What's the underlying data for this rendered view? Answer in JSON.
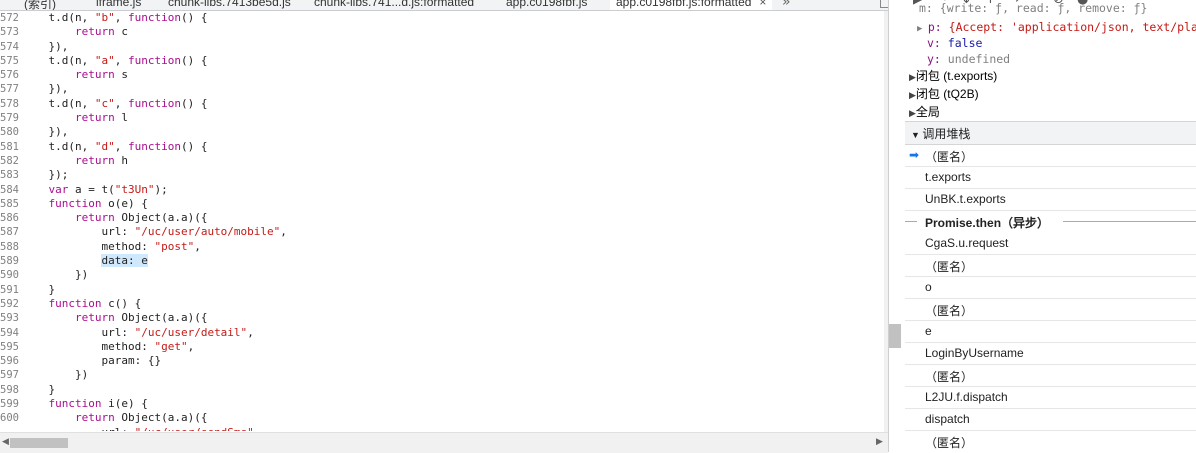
{
  "tabs": [
    {
      "label": "(索引)",
      "active": false
    },
    {
      "label": "iframe.js",
      "active": false
    },
    {
      "label": "chunk-libs.7413be5d.js",
      "active": false
    },
    {
      "label": "chunk-libs.741...d.js:formatted",
      "active": false
    },
    {
      "label": "app.c0198fbf.js",
      "active": false
    },
    {
      "label": "app.c0198fbf.js:formatted",
      "active": true
    }
  ],
  "tab_close": "×",
  "tab_more": "»",
  "code": {
    "line_numbers": [
      "572",
      "573",
      "574",
      "575",
      "576",
      "577",
      "578",
      "579",
      "580",
      "581",
      "582",
      "583",
      "584",
      "585",
      "586",
      "587",
      "588",
      "589",
      "590",
      "591",
      "592",
      "593",
      "594",
      "595",
      "596",
      "597",
      "598",
      "599",
      "600"
    ],
    "lines": [
      "    t.d(n, \"b\", function() {",
      "        return c",
      "    }),",
      "    t.d(n, \"a\", function() {",
      "        return s",
      "    }),",
      "    t.d(n, \"c\", function() {",
      "        return l",
      "    }),",
      "    t.d(n, \"d\", function() {",
      "        return h",
      "    });",
      "    var a = t(\"t3Un\");",
      "    function o(e) {",
      "        return Object(a.a)({",
      "            url: \"/uc/user/auto/mobile\",",
      "            method: \"post\",",
      "            data: e",
      "        })",
      "    }",
      "    function c() {",
      "        return Object(a.a)({",
      "            url: \"/uc/user/detail\",",
      "            method: \"get\",",
      "            param: {}",
      "        })",
      "    }",
      "    function i(e) {",
      "        return Object(a.a)({",
      "            url: \"/uc/user/sendSms\","
    ],
    "highlighted_line_index": 17
  },
  "scope": {
    "top_partial": "m: {write: ƒ, read: ƒ, remove: ƒ}",
    "p_key": "p:",
    "p_value": "{Accept: 'application/json, text/plain",
    "v_key": "v:",
    "v_value": "false",
    "y_key": "y:",
    "y_value": "undefined",
    "closure1": "闭包 (t.exports)",
    "closure2": "闭包 (tQ2B)",
    "global": "全局"
  },
  "call_stack": {
    "title": "调用堆栈",
    "frames": [
      {
        "label": "（匿名）",
        "type": "frame",
        "current": true
      },
      {
        "label": "t.exports",
        "type": "frame"
      },
      {
        "label": "UnBK.t.exports",
        "type": "frame"
      },
      {
        "label": "Promise.then（异步）",
        "type": "async"
      },
      {
        "label": "CgaS.u.request",
        "type": "frame"
      },
      {
        "label": "（匿名）",
        "type": "frame"
      },
      {
        "label": "o",
        "type": "frame"
      },
      {
        "label": "（匿名）",
        "type": "frame"
      },
      {
        "label": "e",
        "type": "frame"
      },
      {
        "label": "LoginByUsername",
        "type": "frame"
      },
      {
        "label": "（匿名）",
        "type": "frame"
      },
      {
        "label": "L2JU.f.dispatch",
        "type": "frame"
      },
      {
        "label": "dispatch",
        "type": "frame"
      },
      {
        "label": "（匿名）",
        "type": "frame"
      }
    ]
  },
  "colors": {
    "keyword": "#aa0d91",
    "string": "#c41a16",
    "highlight": "#cfe8fc",
    "accent": "#1a73e8"
  }
}
